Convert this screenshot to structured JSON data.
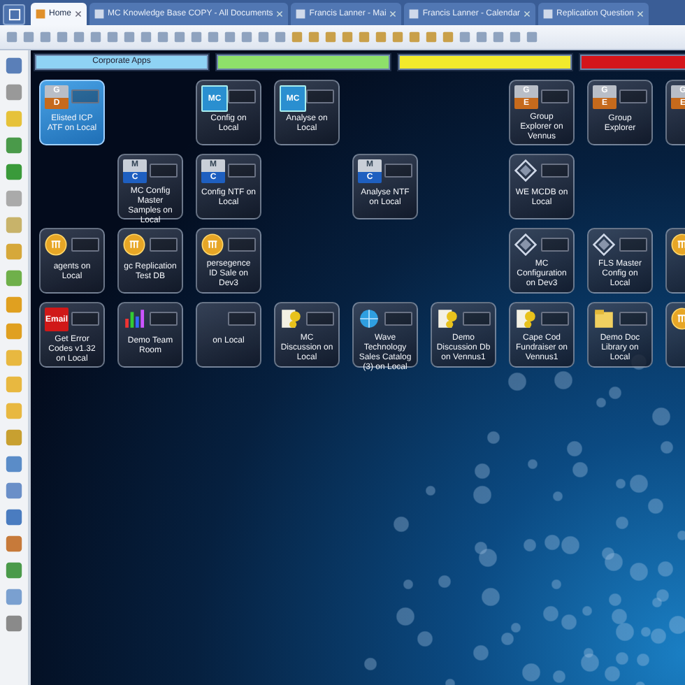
{
  "tabs": [
    {
      "label": "Home",
      "selected": true
    },
    {
      "label": "MC Knowledge Base COPY - All Documents",
      "selected": false
    },
    {
      "label": "Francis Lanner - Mai",
      "selected": false
    },
    {
      "label": "Francis Lanner - Calendar",
      "selected": false
    },
    {
      "label": "Replication Question",
      "selected": false
    }
  ],
  "category_bars": [
    {
      "label": "Corporate Apps",
      "color": "#8fd3f4"
    },
    {
      "color": "#8ee06a"
    },
    {
      "color": "#f2ea2c"
    },
    {
      "color": "#d4151b"
    }
  ],
  "tile_rows": [
    [
      {
        "kind": "ge",
        "icon_text": [
          "G",
          "D"
        ],
        "label": "Elisted ICP ATF on Local",
        "selected": true
      },
      {
        "kind": "empty"
      },
      {
        "kind": "mc",
        "icon_text": [
          "MC"
        ],
        "label": "Config on Local",
        "selected": false
      },
      {
        "kind": "mc",
        "icon_text": [
          "MC"
        ],
        "label": "Analyse on Local",
        "selected": false
      },
      {
        "kind": "empty"
      },
      {
        "kind": "empty"
      },
      {
        "kind": "ge",
        "icon_text": [
          "G",
          "E"
        ],
        "label": "Group Explorer on Vennus",
        "selected": false
      },
      {
        "kind": "ge",
        "icon_text": [
          "G",
          "E"
        ],
        "label": "Group Explorer",
        "selected": false
      },
      {
        "kind": "ge",
        "icon_text": [
          "G",
          "E"
        ],
        "selected": false
      }
    ],
    [
      {
        "kind": "empty"
      },
      {
        "kind": "mc2",
        "icon_text": [
          "M",
          "C"
        ],
        "label": "MC Config Master Samples on Local",
        "selected": false
      },
      {
        "kind": "mc2",
        "icon_text": [
          "M",
          "C"
        ],
        "label": "Config NTF on Local",
        "selected": false
      },
      {
        "kind": "empty"
      },
      {
        "kind": "mc2",
        "icon_text": [
          "M",
          "C"
        ],
        "label": "Analyse NTF on Local",
        "selected": false
      },
      {
        "kind": "empty"
      },
      {
        "kind": "diamond",
        "label": "WE MCDB on Local",
        "selected": false
      },
      {
        "kind": "empty"
      },
      {
        "kind": "empty"
      }
    ],
    [
      {
        "kind": "coin",
        "label": "agents on Local",
        "selected": false
      },
      {
        "kind": "coin",
        "label": "gc Replication Test DB",
        "selected": false
      },
      {
        "kind": "coin",
        "label": "persegence ID Sale on Dev3",
        "selected": false
      },
      {
        "kind": "empty"
      },
      {
        "kind": "empty"
      },
      {
        "kind": "empty"
      },
      {
        "kind": "diamond",
        "label": "MC Configuration on Dev3",
        "selected": false
      },
      {
        "kind": "diamond",
        "label": "FLS Master Config on Local",
        "selected": false
      },
      {
        "kind": "coin",
        "selected": false
      }
    ],
    [
      {
        "kind": "email",
        "icon_text": [
          "Email"
        ],
        "label": "Get Error Codes v1.32 on Local",
        "selected": false
      },
      {
        "kind": "chart",
        "label": "Demo Team Room",
        "selected": false
      },
      {
        "kind": "blank",
        "label": "on Local",
        "selected": false
      },
      {
        "kind": "doc",
        "label": "MC Discussion on Local",
        "selected": false
      },
      {
        "kind": "globe",
        "label": "Wave Technology Sales Catalog (3) on Local",
        "selected": false
      },
      {
        "kind": "doc",
        "label": "Demo Discussion Db on Vennus1",
        "selected": false
      },
      {
        "kind": "doc",
        "label": "Cape Cod Fundraiser on Vennus1",
        "selected": false
      },
      {
        "kind": "folder",
        "label": "Demo Doc Library on Local",
        "selected": false
      },
      {
        "kind": "coin",
        "selected": false
      }
    ]
  ]
}
